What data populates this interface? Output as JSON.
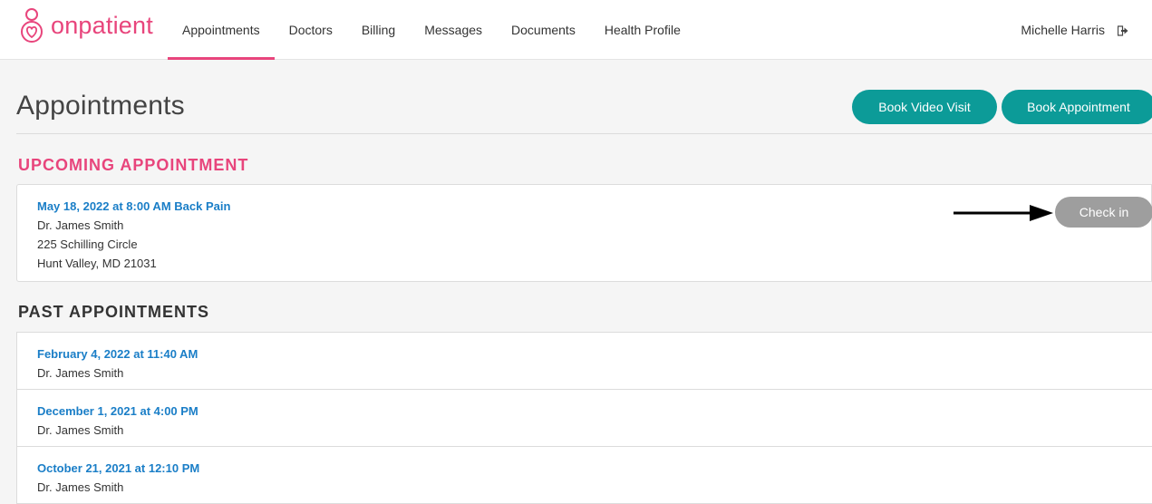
{
  "brand": {
    "name": "onpatient",
    "logo_icon": "onpatient-heart-logo-icon",
    "accent_color": "#e8457c",
    "button_color": "#0c9b98",
    "link_color": "#1a7ec7"
  },
  "nav": {
    "items": [
      {
        "label": "Appointments",
        "active": true
      },
      {
        "label": "Doctors",
        "active": false
      },
      {
        "label": "Billing",
        "active": false
      },
      {
        "label": "Messages",
        "active": false
      },
      {
        "label": "Documents",
        "active": false
      },
      {
        "label": "Health Profile",
        "active": false
      }
    ],
    "user_name": "Michelle Harris",
    "logout_icon": "logout-icon"
  },
  "page": {
    "title": "Appointments",
    "book_video_label": "Book Video Visit",
    "book_appt_label": "Book Appointment"
  },
  "upcoming": {
    "heading": "UPCOMING APPOINTMENT",
    "date_reason": "May 18, 2022 at 8:00 AM Back Pain",
    "doctor": "Dr. James Smith",
    "address1": "225 Schilling Circle",
    "address2": "Hunt Valley, MD 21031",
    "checkin_label": "Check in",
    "annotation_icon": "arrow-right-icon"
  },
  "past": {
    "heading": "PAST APPOINTMENTS",
    "rows": [
      {
        "date": "February 4, 2022 at 11:40 AM",
        "doctor": "Dr. James Smith"
      },
      {
        "date": "December 1, 2021 at 4:00 PM",
        "doctor": "Dr. James Smith"
      },
      {
        "date": "October 21, 2021 at 12:10 PM",
        "doctor": "Dr. James Smith"
      }
    ]
  }
}
